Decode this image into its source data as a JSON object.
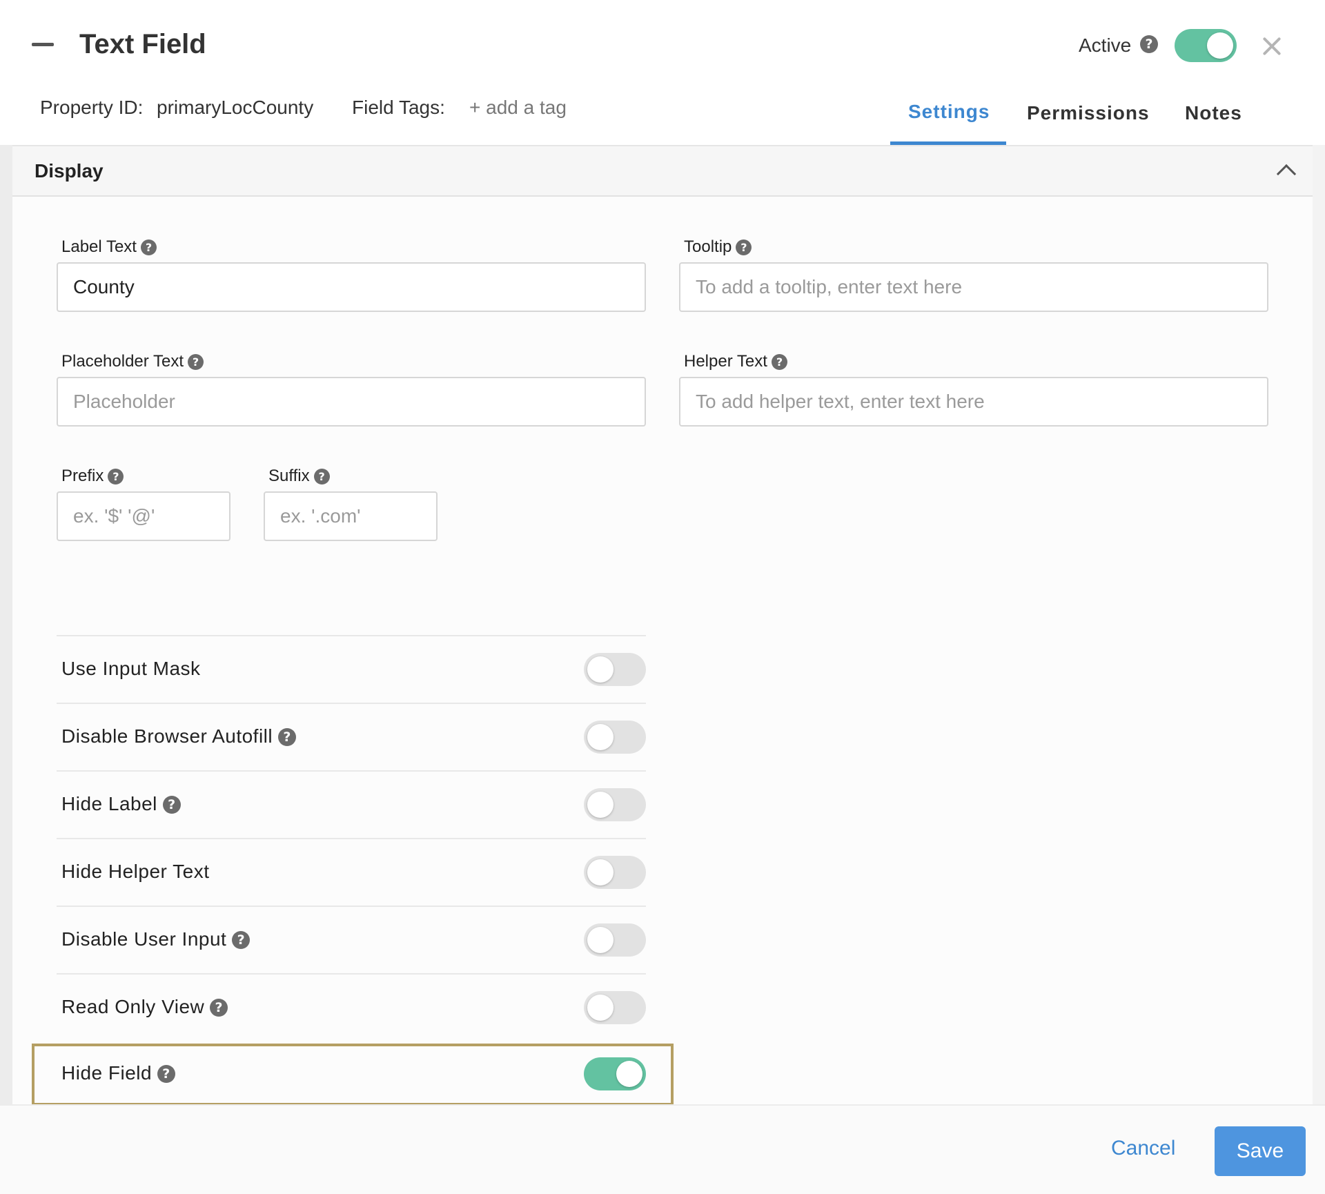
{
  "header": {
    "title": "Text Field",
    "active_label": "Active",
    "active_on": true
  },
  "meta": {
    "property_id_label": "Property ID:",
    "property_id_value": "primaryLocCounty",
    "field_tags_label": "Field Tags:",
    "add_tag_label": "+ add a tag"
  },
  "tabs": [
    {
      "label": "Settings",
      "active": true
    },
    {
      "label": "Permissions",
      "active": false
    },
    {
      "label": "Notes",
      "active": false
    }
  ],
  "section": {
    "title": "Display"
  },
  "fields": {
    "label_text": {
      "label": "Label Text",
      "value": "County",
      "placeholder": ""
    },
    "tooltip": {
      "label": "Tooltip",
      "value": "",
      "placeholder": "To add a tooltip, enter text here"
    },
    "placeholder_text": {
      "label": "Placeholder Text",
      "value": "",
      "placeholder": "Placeholder"
    },
    "helper_text": {
      "label": "Helper Text",
      "value": "",
      "placeholder": "To add helper text, enter text here"
    },
    "prefix": {
      "label": "Prefix",
      "value": "",
      "placeholder": "ex. '$' '@'"
    },
    "suffix": {
      "label": "Suffix",
      "value": "",
      "placeholder": "ex. '.com'"
    }
  },
  "toggles": [
    {
      "label": "Use Input Mask",
      "help": false,
      "on": false
    },
    {
      "label": "Disable Browser Autofill",
      "help": true,
      "on": false
    },
    {
      "label": "Hide Label",
      "help": true,
      "on": false
    },
    {
      "label": "Hide Helper Text",
      "help": false,
      "on": false
    },
    {
      "label": "Disable User Input",
      "help": true,
      "on": false
    },
    {
      "label": "Read Only View",
      "help": true,
      "on": false
    },
    {
      "label": "Hide Field",
      "help": true,
      "on": true
    }
  ],
  "footer": {
    "cancel_label": "Cancel",
    "save_label": "Save"
  },
  "colors": {
    "accent": "#3d87d0",
    "toggle_on": "#63c2a1",
    "highlight": "#b59f63"
  },
  "icons": {
    "collapse": "minus-icon",
    "close": "close-icon",
    "help": "question-circle-icon",
    "section_toggle": "chevron-up-icon"
  }
}
